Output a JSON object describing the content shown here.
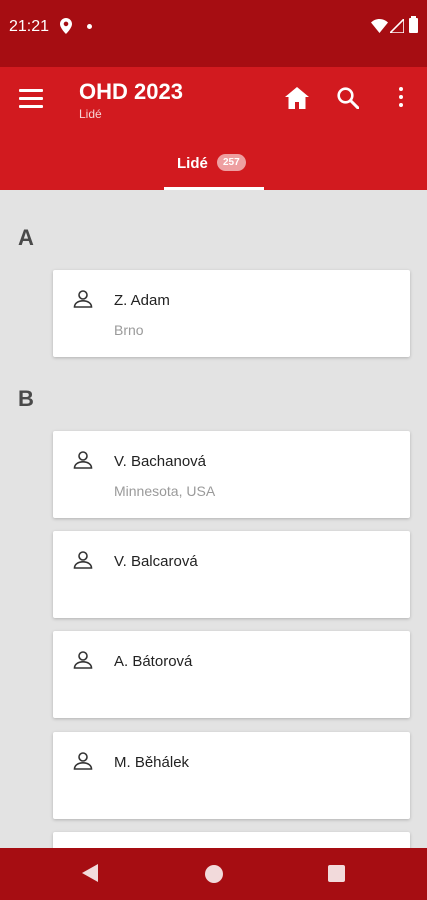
{
  "status_bar": {
    "time": "21:21"
  },
  "app_bar": {
    "title": "OHD 2023",
    "subtitle": "Lidé",
    "icons": [
      "menu-icon",
      "home-icon",
      "search-icon",
      "more-vert-icon"
    ]
  },
  "tab": {
    "label": "Lidé",
    "count": "257"
  },
  "sections": [
    {
      "letter": "A",
      "people": [
        {
          "name": "Z. Adam",
          "location": "Brno"
        }
      ]
    },
    {
      "letter": "B",
      "people": [
        {
          "name": "V. Bachanová",
          "location": "Minnesota, USA"
        },
        {
          "name": "V. Balcarová",
          "location": ""
        },
        {
          "name": "A. Bátorová",
          "location": ""
        },
        {
          "name": "M. Běhálek",
          "location": ""
        }
      ]
    }
  ],
  "colors": {
    "status_bar": "#a60d12",
    "app_bar": "#d21a1f",
    "background": "#e3e3e3",
    "nav_bar": "#a60d12"
  }
}
